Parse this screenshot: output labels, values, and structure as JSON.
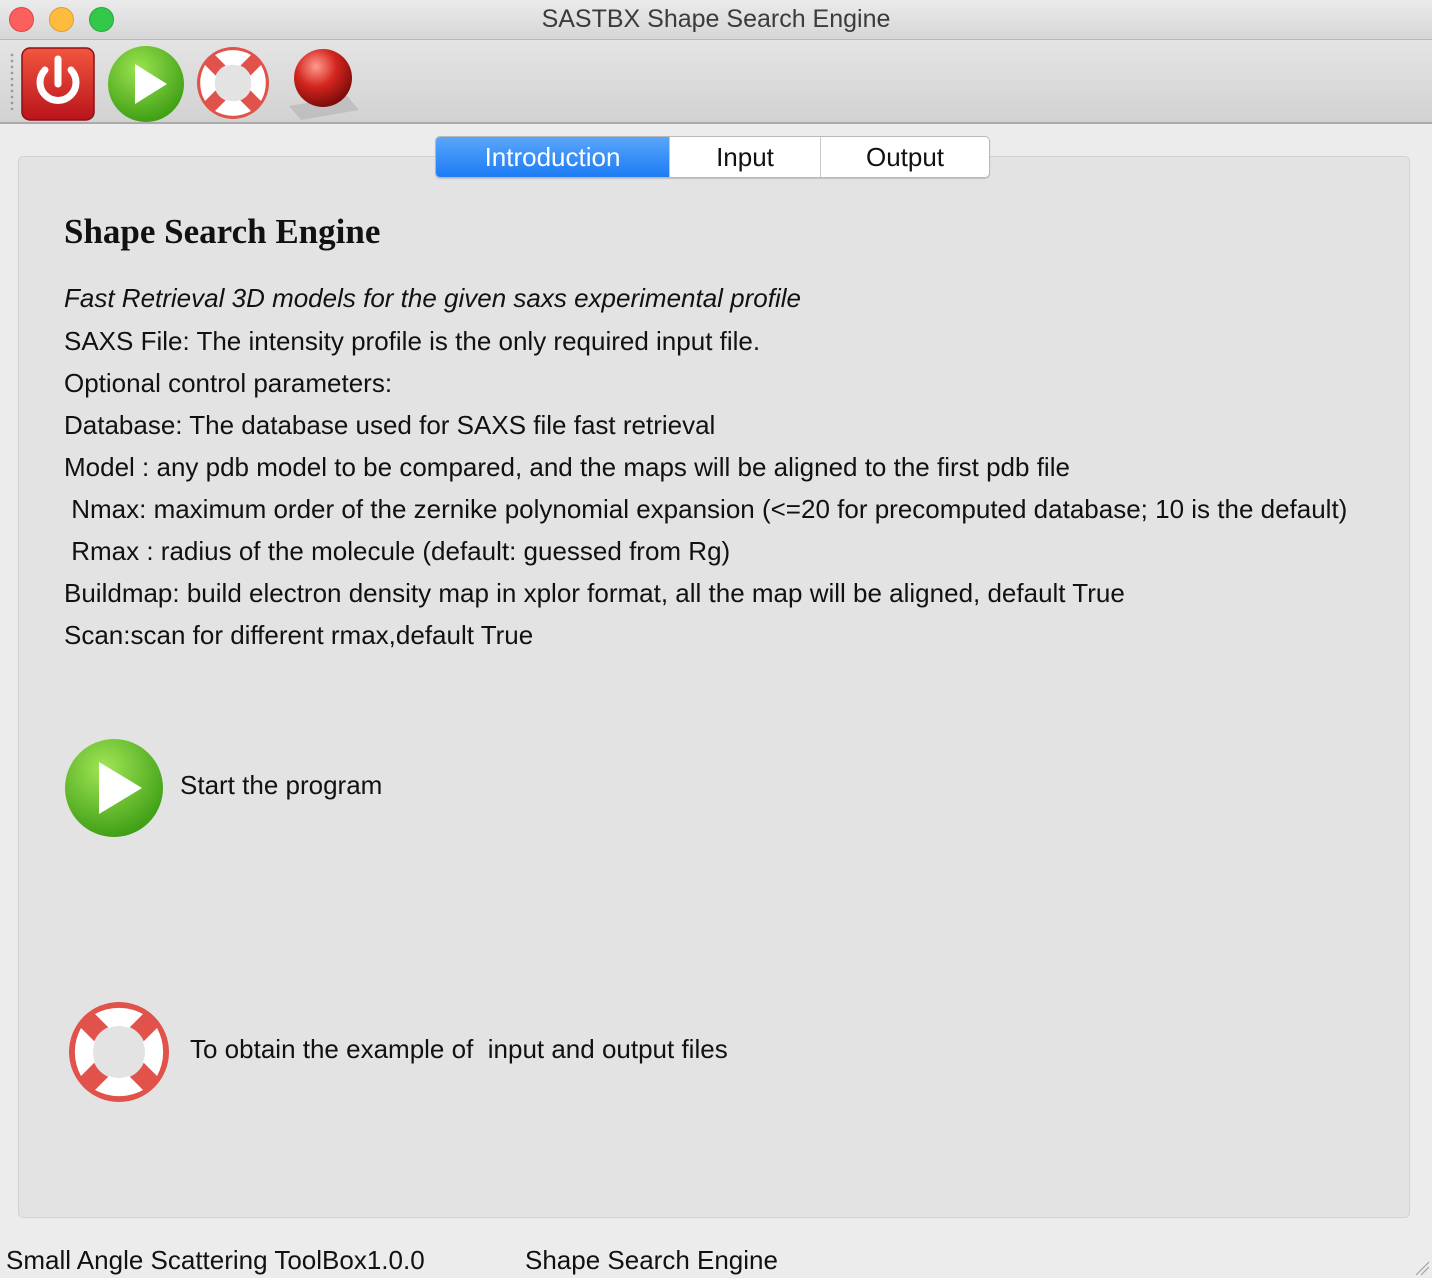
{
  "window": {
    "title": "SASTBX Shape Search Engine"
  },
  "toolbar": {
    "buttons": [
      {
        "icon": "power-icon",
        "color": "#d9252a"
      },
      {
        "icon": "play-icon",
        "color": "#4cbf21"
      },
      {
        "icon": "lifebuoy-icon",
        "color": "#e0524a"
      },
      {
        "icon": "red-sphere-icon",
        "color": "#c9201e"
      }
    ]
  },
  "tabs": [
    {
      "label": "Introduction",
      "active": true
    },
    {
      "label": "Input",
      "active": false
    },
    {
      "label": "Output",
      "active": false
    }
  ],
  "intro": {
    "heading": "Shape Search Engine",
    "subtitle": "Fast Retrieval 3D models for the given saxs experimental profile",
    "lines": [
      "SAXS File: The intensity profile is the only required input file.",
      "Optional control parameters:",
      "Database: The database used for SAXS file  fast retrieval",
      "Model : any pdb model to be compared, and the maps will be aligned to the first pdb file",
      " Nmax: maximum order of the zernike polynomial expansion (<=20 for precomputed database; 10 is the default)",
      " Rmax : radius of the molecule (default: guessed from Rg)",
      "Buildmap: build electron density map in xplor format, all the map will be aligned, default True",
      "Scan:scan for different rmax,default True"
    ],
    "start_label": "Start the program",
    "example_label": "To obtain the example of  input and output files"
  },
  "statusbar": {
    "left": "Small Angle Scattering ToolBox1.0.0",
    "right": "Shape Search Engine"
  },
  "colors": {
    "tab_active": "#1c7bf4",
    "background": "#ececec",
    "panel": "#e3e3e3"
  }
}
